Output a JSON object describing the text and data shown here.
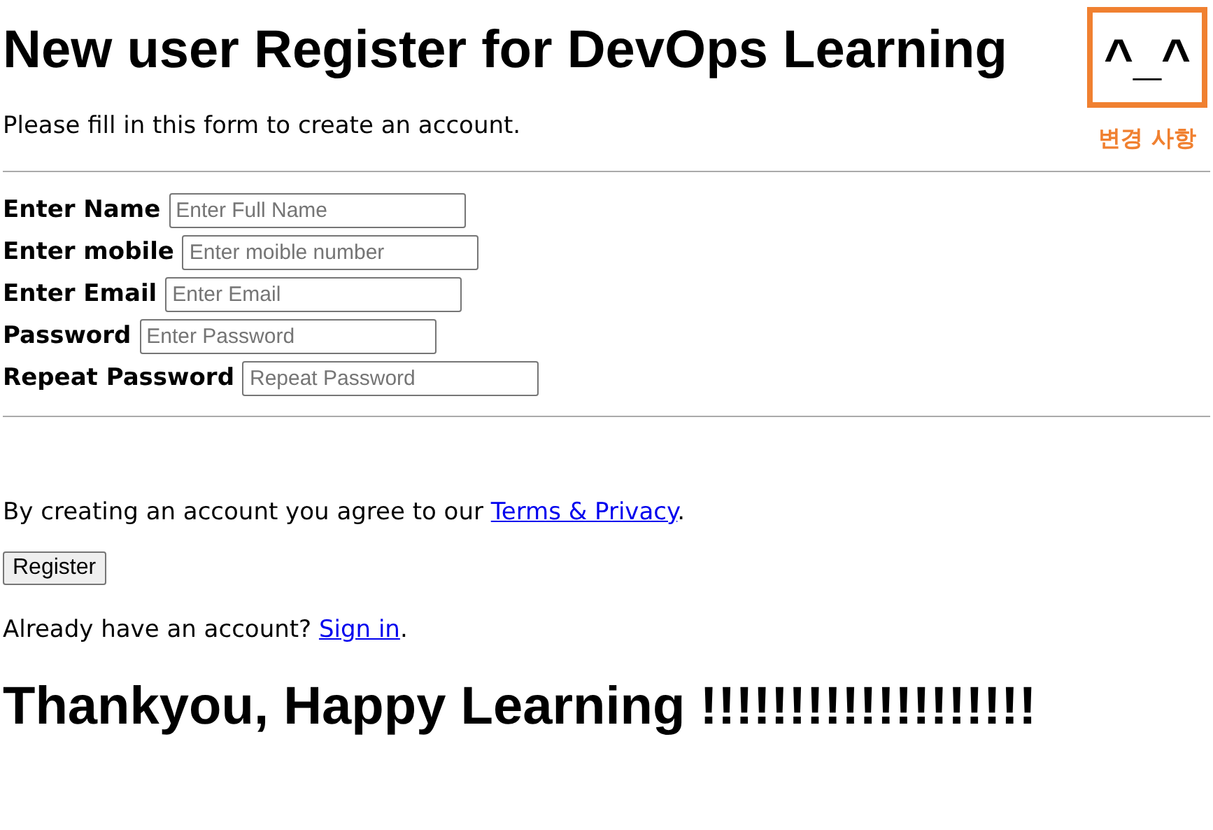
{
  "heading": {
    "title": "New user Register for DevOps Learning",
    "emoticon": "^_^"
  },
  "annotation": {
    "label": "변경 사항"
  },
  "intro": "Please fill in this form to create an account.",
  "fields": [
    {
      "label": "Enter Name",
      "placeholder": "Enter Full Name"
    },
    {
      "label": "Enter mobile",
      "placeholder": "Enter moible number"
    },
    {
      "label": "Enter Email",
      "placeholder": "Enter Email"
    },
    {
      "label": "Password",
      "placeholder": "Enter Password"
    },
    {
      "label": "Repeat Password",
      "placeholder": "Repeat Password"
    }
  ],
  "terms": {
    "text": "By creating an account you agree to our",
    "link": "Terms & Privacy",
    "end": "."
  },
  "register_button": "Register",
  "signin": {
    "text": "Already have an account?",
    "link": "Sign in",
    "end": "."
  },
  "footer_heading": "Thankyou, Happy Learning !!!!!!!!!!!!!!!!!!!"
}
